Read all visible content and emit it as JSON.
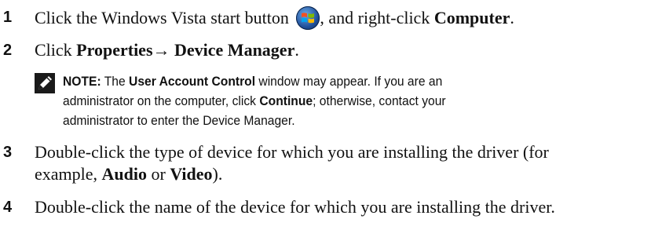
{
  "steps": [
    {
      "number": "1",
      "text_a": "Click the Windows Vista start button ",
      "text_b": ", and right-click ",
      "bold_a": "Computer",
      "text_c": "."
    },
    {
      "number": "2",
      "text_a": "Click ",
      "bold_a": "Properties",
      "arrow": "→",
      "bold_b": " Device Manager",
      "text_b": "."
    },
    {
      "number": "3",
      "line1": "Double-click the type of device for which you are installing the driver (for",
      "line2_a": "example, ",
      "bold_a": "Audio",
      "line2_b": " or ",
      "bold_b": "Video",
      "line2_c": ")."
    },
    {
      "number": "4",
      "text": "Double-click the name of the device for which you are installing the driver."
    }
  ],
  "note": {
    "label": "NOTE:",
    "l1_a": " The ",
    "l1_bold": "User Account Control",
    "l1_b": " window may appear. If you are an",
    "l2_a": "administrator on the computer, click ",
    "l2_bold": "Continue",
    "l2_b": "; otherwise, contact your",
    "l3": "administrator to enter the Device Manager."
  },
  "icons": {
    "start_button": "windows-vista-start-icon",
    "note": "note-pencil-icon"
  }
}
